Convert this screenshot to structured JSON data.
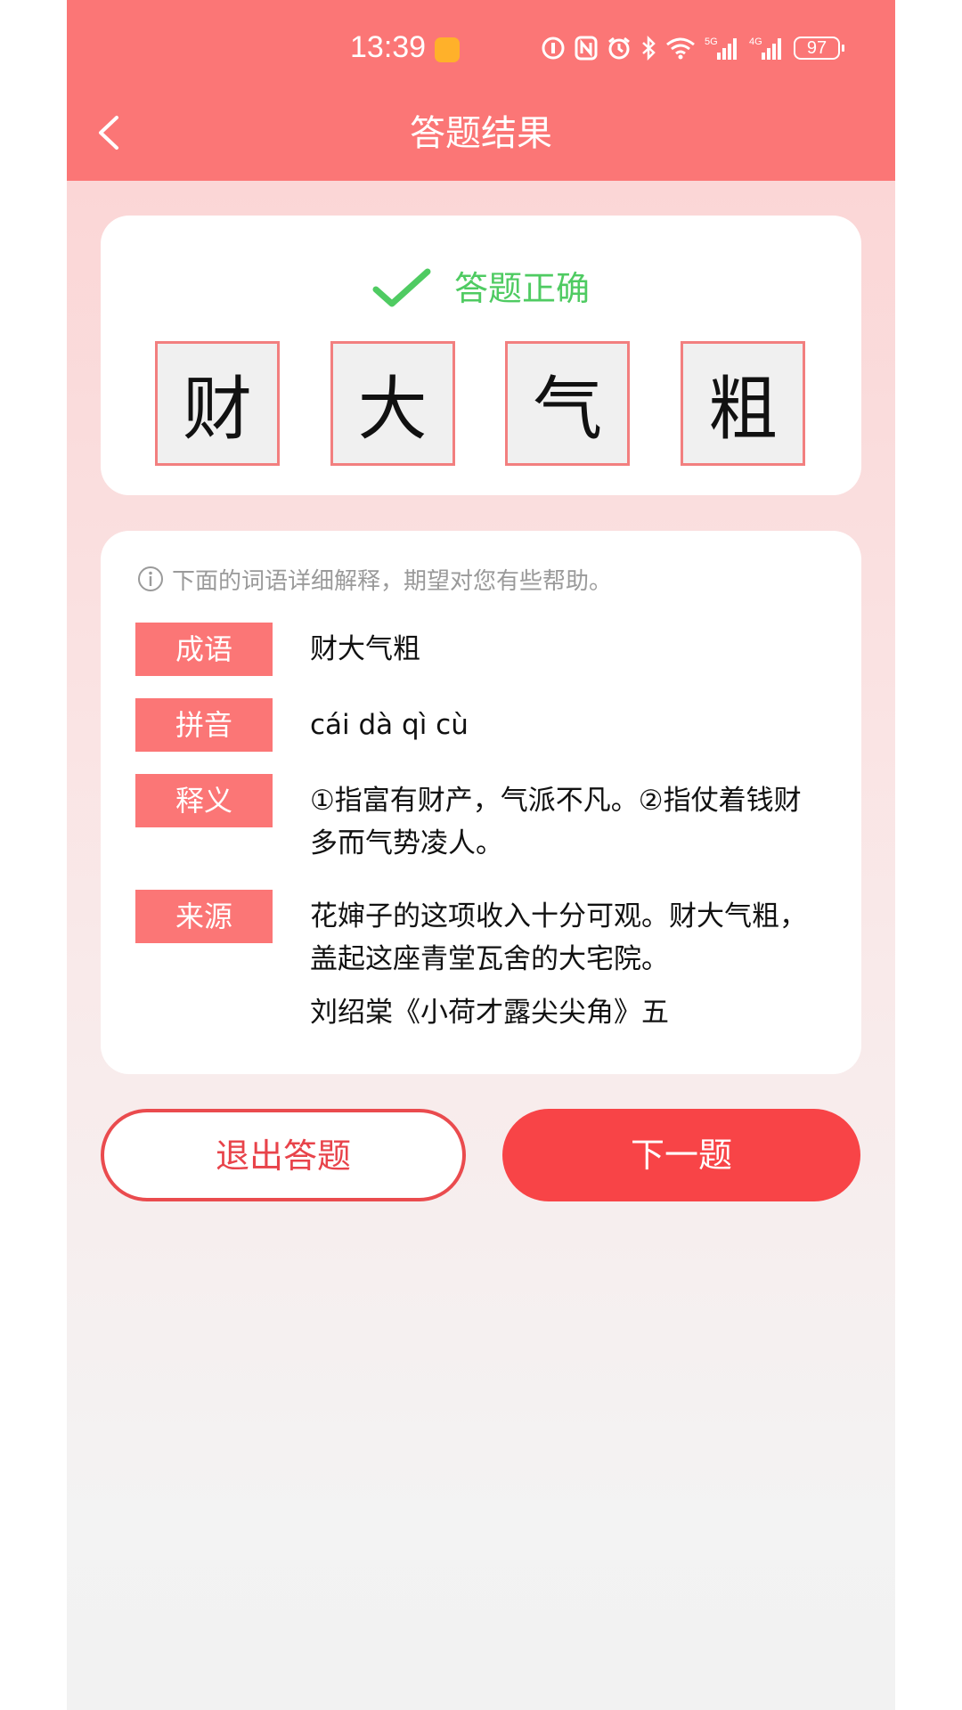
{
  "status_bar": {
    "time": "13:39",
    "battery": "97",
    "net_5g": "5G",
    "net_4g": "4G"
  },
  "header": {
    "title": "答题结果"
  },
  "result": {
    "status_text": "答题正确",
    "status_color": "#4fcb62",
    "characters": [
      "财",
      "大",
      "气",
      "粗"
    ]
  },
  "detail": {
    "hint": "下面的词语详细解释，期望对您有些帮助。",
    "idiom": {
      "label": "成语",
      "value": "财大气粗"
    },
    "pinyin": {
      "label": "拼音",
      "value": "cái dà qì cù"
    },
    "meaning": {
      "label": "释义",
      "value": "①指富有财产，气派不凡。②指仗着钱财多而气势凌人。"
    },
    "source": {
      "label": "来源",
      "quote": "花婶子的这项收入十分可观。财大气粗，盖起这座青堂瓦舍的大宅院。",
      "citation": "刘绍棠《小荷才露尖尖角》五"
    }
  },
  "buttons": {
    "exit": "退出答题",
    "next": "下一题"
  },
  "colors": {
    "header": "#fb7676",
    "tag": "#fb7676",
    "primary_button": "#f84447"
  }
}
